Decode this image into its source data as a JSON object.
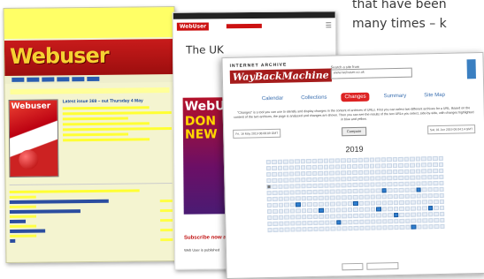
{
  "caption": {
    "line1": "that have been",
    "line2": "many times – k"
  },
  "old_site": {
    "logo": "Webuser",
    "latest_issue": "Latest issue 369 – out Thursday 4 May",
    "cover_title": "Webuser"
  },
  "new_site": {
    "logo": "WebUser",
    "headline": "The UK",
    "cover_brand": "WebU",
    "cover_big1": "DON",
    "cover_big2": "NEW",
    "subscribe": "Subscribe now ar",
    "footer": "Web User is published"
  },
  "wayback": {
    "logo_top": "INTERNET ARCHIVE",
    "logo_main": "WayBackMachine",
    "search_label": "Search a site from",
    "search_value": "www.webuser.co.uk",
    "tabs": [
      {
        "label": "Calendar"
      },
      {
        "label": "Collections"
      },
      {
        "label": "Changes"
      },
      {
        "label": "Summary"
      },
      {
        "label": "Site Map"
      }
    ],
    "description": "\"Changes\" is a tool you can use to identify and display changes in the content of archives of URLs. First you can select two different archives for a URL. Based on the content of the two archives, the page is analysed and changes are shown. Then you can see the results of the two URLs you select, side-by-side, with changes highlighted in blue and yellow.",
    "compare_label": "Compare",
    "left_select": "Fri, 16 May 2019 08:08:09 GMT",
    "right_select": "Sat, 01 Jun 2019 09:04:14 GMT",
    "year": "2019"
  }
}
